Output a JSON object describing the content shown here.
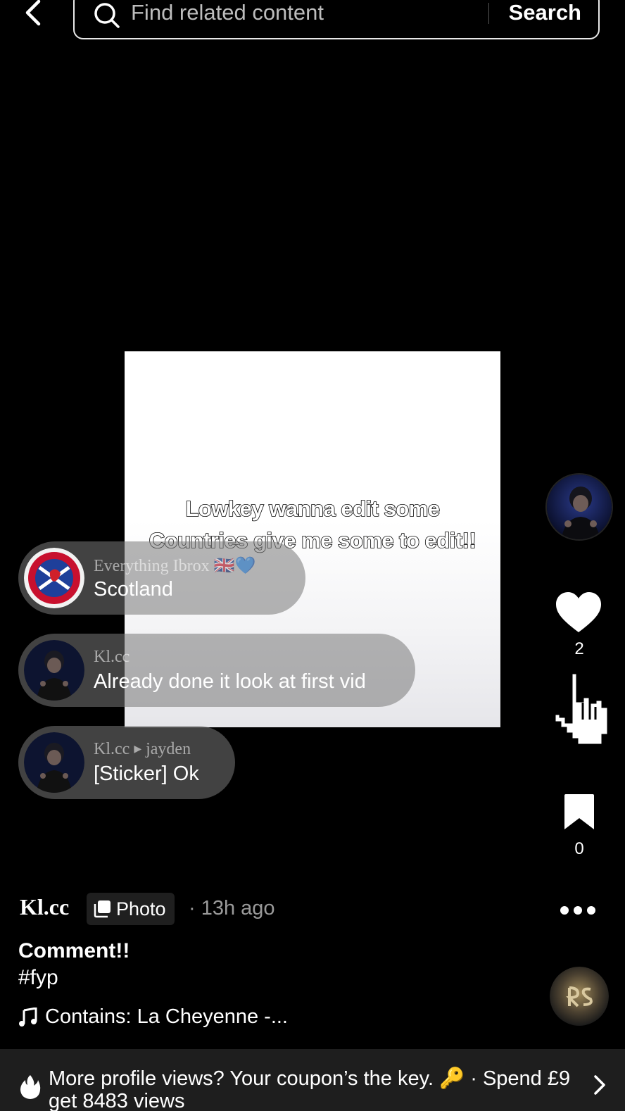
{
  "search": {
    "placeholder": "Find related content",
    "submit_label": "Search"
  },
  "post": {
    "image_text": "Lowkey wanna edit some Countries give me some to edit!!",
    "author": "Kl.cc",
    "type_label": "Photo",
    "time": "· 13h ago",
    "caption": "Comment!!",
    "hashtag": "#fyp",
    "music": "Contains: La Cheyenne -..."
  },
  "comments": [
    {
      "author": "Everything Ibrox 🇬🇧💙",
      "text": "Scotland"
    },
    {
      "author": "Kl.cc",
      "text": "Already done it look at first vid"
    },
    {
      "author": "Kl.cc",
      "reply_to": "jayden",
      "text": "[Sticker] Ok"
    }
  ],
  "actions": {
    "like_count": "2",
    "save_count": "0"
  },
  "promo": {
    "text": "More profile views? Your coupon’s the key. 🔑 · Spend £9 get 8483 views"
  },
  "icons": {
    "back": "chevron-left-icon",
    "search": "search-icon",
    "like": "heart-icon",
    "save": "bookmark-icon",
    "more": "ellipsis-icon",
    "music": "music-note-icon",
    "promo": "flame-icon",
    "promo_go": "chevron-right-icon",
    "pointer": "hand-cursor-icon"
  },
  "colors": {
    "background": "#000000",
    "promo_bar": "#1e1e1e",
    "comment_bubble": "rgba(120,120,120,0.55)"
  }
}
